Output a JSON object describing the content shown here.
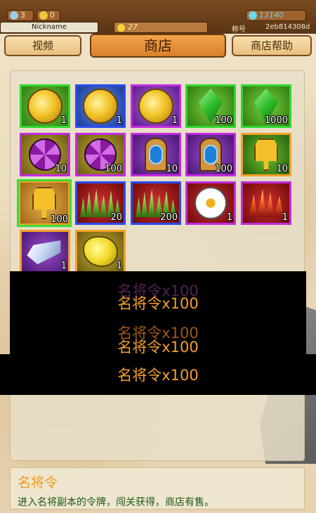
{
  "topbar": {
    "stars": "3",
    "vip": "0",
    "gems": "13140",
    "nickname": "Nickname",
    "coins": "27",
    "id_label": "称号",
    "id_value": "2eb814308d"
  },
  "tabs": {
    "video": "视频",
    "shop": "商店",
    "help": "商店帮助"
  },
  "items": [
    {
      "name": "gold-coin",
      "count": "1"
    },
    {
      "name": "gold-coin",
      "count": "1"
    },
    {
      "name": "gold-coin",
      "count": "1"
    },
    {
      "name": "green-gem",
      "count": "100"
    },
    {
      "name": "green-gem",
      "count": "1000"
    },
    {
      "name": "purple-flower",
      "count": "10"
    },
    {
      "name": "purple-flower",
      "count": "100"
    },
    {
      "name": "blue-talisman",
      "count": "10"
    },
    {
      "name": "blue-talisman",
      "count": "100"
    },
    {
      "name": "general-token",
      "count": "10"
    },
    {
      "name": "general-token",
      "count": "100"
    },
    {
      "name": "grass-bundle",
      "count": "20"
    },
    {
      "name": "grass-bundle",
      "count": "200"
    },
    {
      "name": "daisy-flower",
      "count": "1"
    },
    {
      "name": "red-grass",
      "count": "1"
    },
    {
      "name": "crystal-shard",
      "count": "1"
    },
    {
      "name": "gold-ore",
      "count": "1"
    }
  ],
  "popup": {
    "line1": "名将令x100",
    "line2": "名将令x100",
    "line3": "名将令x100",
    "line4": "名将令x100",
    "line5": "名将令x100",
    "main": "名将令x100"
  },
  "description": {
    "title": "名将令",
    "body": "进入名将副本的令牌，闯关获得，商店有售。"
  }
}
